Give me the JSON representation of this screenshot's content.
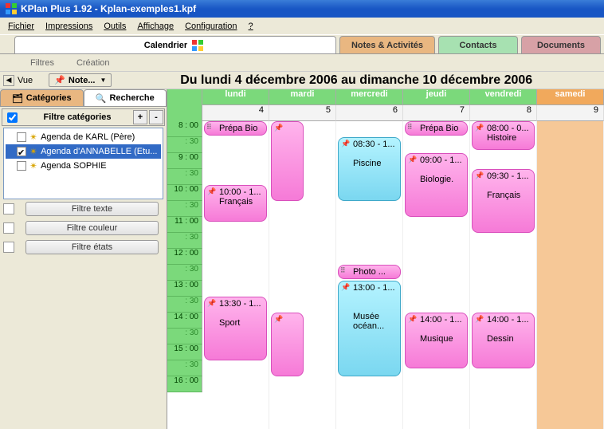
{
  "window": {
    "title": "KPlan Plus 1.92 - Kplan-exemples1.kpf"
  },
  "menu": {
    "fichier": "Fichier",
    "impressions": "Impressions",
    "outils": "Outils",
    "affichage": "Affichage",
    "configuration": "Configuration",
    "help": "?"
  },
  "tabs": {
    "calendrier": "Calendrier",
    "notes": "Notes & Activités",
    "contacts": "Contacts",
    "documents": "Documents"
  },
  "subtabs": {
    "filtres": "Filtres",
    "creation": "Création"
  },
  "vue": {
    "label": "Vue",
    "notes_btn": "Note..."
  },
  "date_range": "Du lundi 4 décembre 2006 au dimanche 10 décembre 2006",
  "sidebar": {
    "tabs": {
      "categories": "Catégories",
      "recherche": "Recherche"
    },
    "filter_head": {
      "label": "Filtre catégories",
      "plus": "+",
      "minus": "-"
    },
    "agendas": [
      {
        "label": "Agenda  de KARL (Père)",
        "checked": false,
        "selected": false
      },
      {
        "label": "Agenda d'ANNABELLE  (Etu...",
        "checked": true,
        "selected": true
      },
      {
        "label": "Agenda SOPHIE",
        "checked": false,
        "selected": false
      }
    ],
    "filter_text": "Filtre texte",
    "filter_color": "Filtre couleur",
    "filter_state": "Filtre états"
  },
  "calendar": {
    "days": [
      "lundi",
      "mardi",
      "mercredi",
      "jeudi",
      "vendredi",
      "samedi"
    ],
    "daynums": [
      "4",
      "5",
      "6",
      "7",
      "8",
      "9"
    ],
    "time_slots": [
      "8 : 00",
      ": 30",
      "9 : 00",
      ": 30",
      "10 : 00",
      ": 30",
      "11 : 00",
      ": 30",
      "12 : 00",
      ": 30",
      "13 : 00",
      ": 30",
      "14 : 00",
      ": 30",
      "15 : 00",
      ": 30",
      "16 : 00"
    ]
  },
  "events": {
    "lun_prepa": "Prépa Bio",
    "lun_fr": "10:00 - 1...\nFrançais",
    "lun_sport": "13:30 - 1...\n\nSport",
    "mer_pisc": "08:30 - 1...\n\nPiscine",
    "mer_photo": "Photo ...",
    "mer_musee": "13:00 - 1...\n\n\nMusée océan...",
    "jeu_prepa": "Prépa Bio",
    "jeu_bio": "09:00 - 1...\n\nBiologie.",
    "jeu_mus": "14:00 - 1...\n\nMusique",
    "ven_hist": "08:00 - 0...\nHistoire",
    "ven_fr": "09:30 - 1...\n\nFrançais",
    "ven_des": "14:00 - 1...\n\nDessin"
  }
}
